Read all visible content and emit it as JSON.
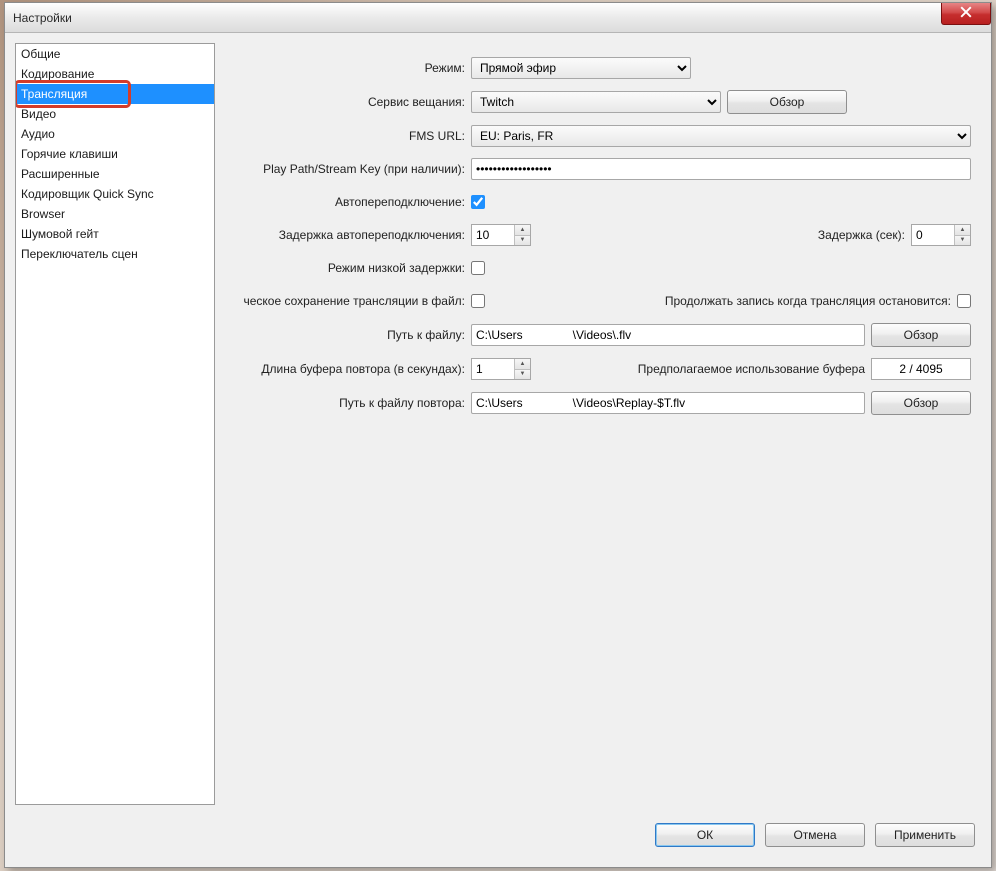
{
  "window": {
    "title": "Настройки"
  },
  "sidebar": {
    "items": [
      {
        "label": "Общие"
      },
      {
        "label": "Кодирование"
      },
      {
        "label": "Трансляция",
        "selected": true,
        "highlighted": true
      },
      {
        "label": "Видео"
      },
      {
        "label": "Аудио"
      },
      {
        "label": "Горячие клавиши"
      },
      {
        "label": "Расширенные"
      },
      {
        "label": "Кодировщик Quick Sync"
      },
      {
        "label": "Browser"
      },
      {
        "label": "Шумовой гейт"
      },
      {
        "label": "Переключатель сцен"
      }
    ]
  },
  "form": {
    "mode_label": "Режим:",
    "mode_value": "Прямой эфир",
    "service_label": "Сервис вещания:",
    "service_value": "Twitch",
    "service_browse": "Обзор",
    "fms_label": "FMS URL:",
    "fms_value": "EU: Paris, FR",
    "playpath_label": "Play Path/Stream Key (при наличии):",
    "playpath_value": "••••••••••••••••••",
    "autoreconnect_label": "Автопереподключение:",
    "autoreconnect_checked": true,
    "reconnect_delay_label": "Задержка автопереподключения:",
    "reconnect_delay_value": "10",
    "delay_sec_label": "Задержка (сек):",
    "delay_sec_value": "0",
    "lowlatency_label": "Режим низкой задержки:",
    "lowlatency_checked": false,
    "savefile_label": "ческое сохранение трансляции в файл:",
    "savefile_checked": false,
    "keeprecording_label": "Продолжать запись когда трансляция остановится:",
    "keeprecording_checked": false,
    "filepath_label": "Путь к файлу:",
    "filepath_value": "C:\\Users               \\Videos\\.flv",
    "filepath_browse": "Обзор",
    "bufferlen_label": "Длина буфера повтора (в секундах):",
    "bufferlen_value": "1",
    "bufferest_label": "Предполагаемое использование буфера",
    "bufferest_value": "2 / 4095",
    "replaypath_label": "Путь к файлу повтора:",
    "replaypath_value": "C:\\Users               \\Videos\\Replay-$T.flv",
    "replaypath_browse": "Обзор"
  },
  "footer": {
    "ok": "ОК",
    "cancel": "Отмена",
    "apply": "Применить"
  }
}
